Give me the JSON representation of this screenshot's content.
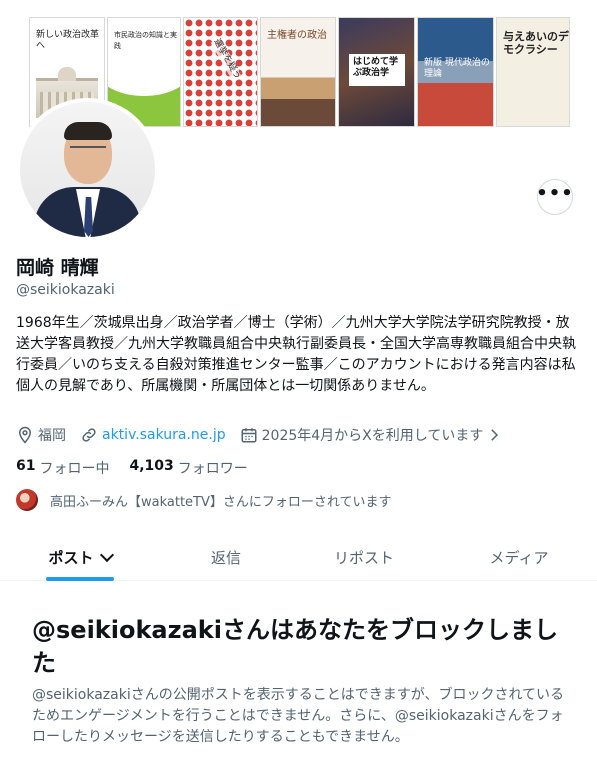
{
  "banner": {
    "books": [
      {
        "title": "新しい政治改革へ"
      },
      {
        "title": "市民政治の知識と実践"
      },
      {
        "title": "選挙を疑う"
      },
      {
        "title": "主権者の政治"
      },
      {
        "title": "はじめて学ぶ政治学"
      },
      {
        "title": "新版 現代政治の理論"
      },
      {
        "title": "与えあいのデモクラシー"
      }
    ]
  },
  "profile": {
    "name": "岡崎 晴輝",
    "handle": "@seikiokazaki",
    "bio": "1968年生／茨城県出身／政治学者／博士（学術）／九州大学大学院法学研究院教授・放送大学客員教授／九州大学教職員組合中央執行副委員長・全国大学高専教職員組合中央執行委員／いのち支える自殺対策推進センター監事／このアカウントにおける発言内容は私個人の見解であり、所属機関・所属団体とは一切関係ありません。",
    "location": "福岡",
    "website": "aktiv.sakura.ne.jp",
    "joined": "2025年4月からXを利用しています",
    "following_count": "61",
    "following_label": "フォロー中",
    "followers_count": "4,103",
    "followers_label": "フォロワー",
    "followed_by": "高田ふーみん【wakatteTV】さんにフォローされています"
  },
  "more_button": {
    "label": "•••"
  },
  "tabs": [
    {
      "label": "ポスト",
      "active": true
    },
    {
      "label": "返信"
    },
    {
      "label": "リポスト"
    },
    {
      "label": "メディア"
    }
  ],
  "blocked": {
    "title": "@seikiokazakiさんはあなたをブロックしました",
    "description": "@seikiokazakiさんの公開ポストを表示することはできますが、ブロックされているためエンゲージメントを行うことはできません。さらに、@seikiokazakiさんをフォローしたりメッセージを送信したりすることもできません。"
  },
  "colors": {
    "accent": "#1d9bf0",
    "text_primary": "#0f1419",
    "text_secondary": "#536471"
  }
}
